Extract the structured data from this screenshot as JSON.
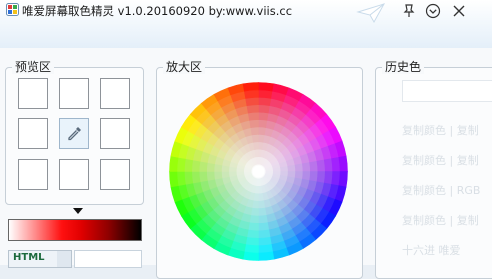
{
  "window": {
    "title": "唯爱屏幕取色精灵 v1.0.20160920 by:www.viis.cc"
  },
  "titlebar_buttons": [
    {
      "name": "pin-button",
      "icon": "pin-icon"
    },
    {
      "name": "menu-button",
      "icon": "chevron-down-icon"
    },
    {
      "name": "close-button",
      "icon": "close-icon"
    }
  ],
  "preview": {
    "legend": "预览区",
    "center_icon": "eyedropper-icon",
    "grid_rows": 3,
    "grid_cols": 3
  },
  "magnifier": {
    "legend": "放大区",
    "center_color": "#ffffff"
  },
  "history": {
    "legend": "历史色",
    "rows": [
      "复制颜色 | 复制",
      "复制颜色 | 复制",
      "复制颜色 | RGB",
      "复制颜色 | 复制",
      "十六进 唯爱"
    ]
  },
  "gradient": {
    "colors": [
      "#ffffff",
      "#ff1010",
      "#000000"
    ]
  },
  "format_combo": {
    "value": "HTML"
  },
  "colors": {
    "accent": "#2a7ad8",
    "panel_border": "#c6cfd7"
  }
}
